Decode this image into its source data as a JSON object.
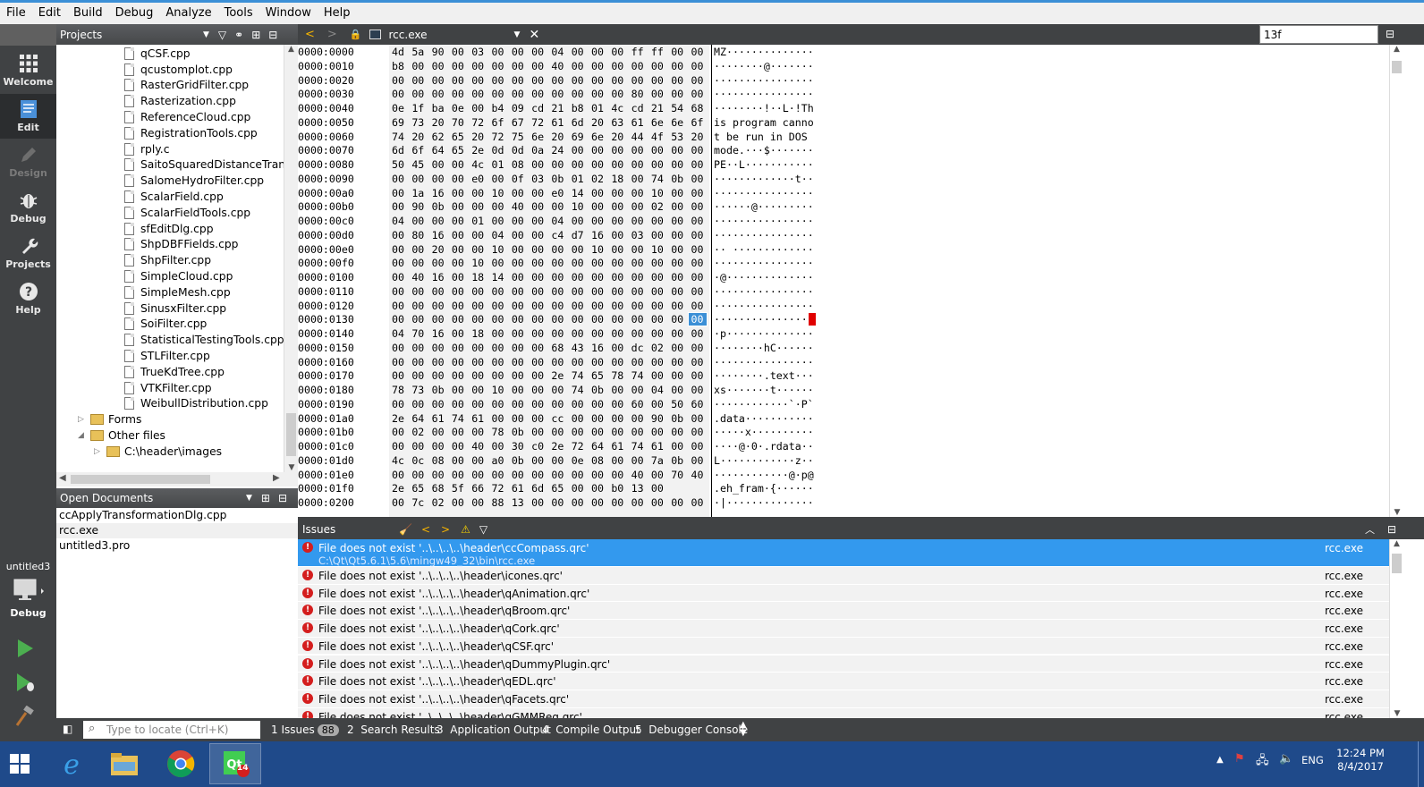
{
  "menu": [
    "File",
    "Edit",
    "Build",
    "Debug",
    "Analyze",
    "Tools",
    "Window",
    "Help"
  ],
  "modes": [
    {
      "label": "Welcome",
      "icon": "grid-icon",
      "state": "normal"
    },
    {
      "label": "Edit",
      "icon": "edit-icon",
      "state": "active"
    },
    {
      "label": "Design",
      "icon": "pencil-icon",
      "state": "disabled"
    },
    {
      "label": "Debug",
      "icon": "bug-icon",
      "state": "normal"
    },
    {
      "label": "Projects",
      "icon": "wrench-icon",
      "state": "normal"
    },
    {
      "label": "Help",
      "icon": "help-icon",
      "state": "normal"
    }
  ],
  "kit": {
    "project": "untitled3",
    "config": "Debug"
  },
  "projects_pane": {
    "title": "Projects",
    "files": [
      "qCSF.cpp",
      "qcustomplot.cpp",
      "RasterGridFilter.cpp",
      "Rasterization.cpp",
      "ReferenceCloud.cpp",
      "RegistrationTools.cpp",
      "rply.c",
      "SaitoSquaredDistanceTransform.cpp",
      "SalomeHydroFilter.cpp",
      "ScalarField.cpp",
      "ScalarFieldTools.cpp",
      "sfEditDlg.cpp",
      "ShpDBFFields.cpp",
      "ShpFilter.cpp",
      "SimpleCloud.cpp",
      "SimpleMesh.cpp",
      "SinusxFilter.cpp",
      "SoiFilter.cpp",
      "StatisticalTestingTools.cpp",
      "STLFilter.cpp",
      "TrueKdTree.cpp",
      "VTKFilter.cpp",
      "WeibullDistribution.cpp"
    ],
    "folders": [
      "Forms",
      "Other files",
      "C:\\header\\images"
    ]
  },
  "open_documents": {
    "title": "Open Documents",
    "items": [
      "ccApplyTransformationDlg.cpp",
      "rcc.exe",
      "untitled3.pro"
    ],
    "selected": 1
  },
  "editor": {
    "tab": "rcc.exe",
    "find_value": "13f"
  },
  "hex": {
    "rows": [
      {
        "addr": "0000:0000",
        "bytes": "4d 5a 90 00 03 00 00 00 04 00 00 00 ff ff 00 00",
        "ascii": "MZ··············"
      },
      {
        "addr": "0000:0010",
        "bytes": "b8 00 00 00 00 00 00 00 40 00 00 00 00 00 00 00",
        "ascii": "········@·······"
      },
      {
        "addr": "0000:0020",
        "bytes": "00 00 00 00 00 00 00 00 00 00 00 00 00 00 00 00",
        "ascii": "················"
      },
      {
        "addr": "0000:0030",
        "bytes": "00 00 00 00 00 00 00 00 00 00 00 00 80 00 00 00",
        "ascii": "················"
      },
      {
        "addr": "0000:0040",
        "bytes": "0e 1f ba 0e 00 b4 09 cd 21 b8 01 4c cd 21 54 68",
        "ascii": "········!··L·!Th"
      },
      {
        "addr": "0000:0050",
        "bytes": "69 73 20 70 72 6f 67 72 61 6d 20 63 61 6e 6e 6f",
        "ascii": "is program canno"
      },
      {
        "addr": "0000:0060",
        "bytes": "74 20 62 65 20 72 75 6e 20 69 6e 20 44 4f 53 20",
        "ascii": "t be run in DOS "
      },
      {
        "addr": "0000:0070",
        "bytes": "6d 6f 64 65 2e 0d 0d 0a 24 00 00 00 00 00 00 00",
        "ascii": "mode.···$·······"
      },
      {
        "addr": "0000:0080",
        "bytes": "50 45 00 00 4c 01 08 00 00 00 00 00 00 00 00 00",
        "ascii": "PE··L···········"
      },
      {
        "addr": "0000:0090",
        "bytes": "00 00 00 00 e0 00 0f 03 0b 01 02 18 00 74 0b 00",
        "ascii": "·············t··"
      },
      {
        "addr": "0000:00a0",
        "bytes": "00 1a 16 00 00 10 00 00 e0 14 00 00 00 10 00 00",
        "ascii": "················"
      },
      {
        "addr": "0000:00b0",
        "bytes": "00 90 0b 00 00 00 40 00 00 10 00 00 00 02 00 00",
        "ascii": "······@·········"
      },
      {
        "addr": "0000:00c0",
        "bytes": "04 00 00 00 01 00 00 00 04 00 00 00 00 00 00 00",
        "ascii": "················"
      },
      {
        "addr": "0000:00d0",
        "bytes": "00 80 16 00 00 04 00 00 c4 d7 16 00 03 00 00 00",
        "ascii": "················"
      },
      {
        "addr": "0000:00e0",
        "bytes": "00 00 20 00 00 10 00 00 00 00 10 00 00 10 00 00",
        "ascii": "·· ·············"
      },
      {
        "addr": "0000:00f0",
        "bytes": "00 00 00 00 10 00 00 00 00 00 00 00 00 00 00 00",
        "ascii": "················"
      },
      {
        "addr": "0000:0100",
        "bytes": "00 40 16 00 18 14 00 00 00 00 00 00 00 00 00 00",
        "ascii": "·@··············"
      },
      {
        "addr": "0000:0110",
        "bytes": "00 00 00 00 00 00 00 00 00 00 00 00 00 00 00 00",
        "ascii": "················"
      },
      {
        "addr": "0000:0120",
        "bytes": "00 00 00 00 00 00 00 00 00 00 00 00 00 00 00 00",
        "ascii": "················"
      },
      {
        "addr": "0000:0130",
        "bytes": "00 00 00 00 00 00 00 00 00 00 00 00 00 00 00 00",
        "ascii": "················"
      },
      {
        "addr": "0000:0140",
        "bytes": "04 70 16 00 18 00 00 00 00 00 00 00 00 00 00 00",
        "ascii": "·p··············"
      },
      {
        "addr": "0000:0150",
        "bytes": "00 00 00 00 00 00 00 00 68 43 16 00 dc 02 00 00",
        "ascii": "········hC······"
      },
      {
        "addr": "0000:0160",
        "bytes": "00 00 00 00 00 00 00 00 00 00 00 00 00 00 00 00",
        "ascii": "················"
      },
      {
        "addr": "0000:0170",
        "bytes": "00 00 00 00 00 00 00 00 2e 74 65 78 74 00 00 00",
        "ascii": "········.text···"
      },
      {
        "addr": "0000:0180",
        "bytes": "78 73 0b 00 00 10 00 00 00 74 0b 00 00 04 00 00",
        "ascii": "xs·······t······"
      },
      {
        "addr": "0000:0190",
        "bytes": "00 00 00 00 00 00 00 00 00 00 00 00 60 00 50 60",
        "ascii": "············`·P`"
      },
      {
        "addr": "0000:01a0",
        "bytes": "2e 64 61 74 61 00 00 00 cc 00 00 00 00 90 0b 00",
        "ascii": ".data···········"
      },
      {
        "addr": "0000:01b0",
        "bytes": "00 02 00 00 00 78 0b 00 00 00 00 00 00 00 00 00",
        "ascii": "·····x··········"
      },
      {
        "addr": "0000:01c0",
        "bytes": "00 00 00 00 40 00 30 c0 2e 72 64 61 74 61 00 00",
        "ascii": "····@·0·.rdata··"
      },
      {
        "addr": "0000:01d0",
        "bytes": "4c 0c 08 00 00 a0 0b 00 00 0e 08 00 00 7a 0b 00",
        "ascii": "L············z··"
      },
      {
        "addr": "0000:01e0",
        "bytes": "00 00 00 00 00 00 00 00 00 00 00 00 40 00 70 40",
        "ascii": "············@·p@"
      },
      {
        "addr": "0000:01f0",
        "bytes": "2e 65 68 5f 66 72 61 6d 65 00 00 b0 13 00",
        "ascii": ".eh_fram·{······"
      },
      {
        "addr": "0000:0200",
        "bytes": "00 7c 02 00 00 88 13 00 00 00 00 00 00 00 00 00",
        "ascii": "·|··············"
      }
    ],
    "cursor": {
      "row": 19,
      "col": 15
    }
  },
  "issues": {
    "title": "Issues",
    "items": [
      {
        "text": "File does not exist '..\\..\\..\\..\\header\\ccCompass.qrc'",
        "sub": "C:\\Qt\\Qt5.6.1\\5.6\\mingw49_32\\bin\\rcc.exe",
        "file": "rcc.exe"
      },
      {
        "text": "File does not exist '..\\..\\..\\..\\header\\icones.qrc'",
        "file": "rcc.exe"
      },
      {
        "text": "File does not exist '..\\..\\..\\..\\header\\qAnimation.qrc'",
        "file": "rcc.exe"
      },
      {
        "text": "File does not exist '..\\..\\..\\..\\header\\qBroom.qrc'",
        "file": "rcc.exe"
      },
      {
        "text": "File does not exist '..\\..\\..\\..\\header\\qCork.qrc'",
        "file": "rcc.exe"
      },
      {
        "text": "File does not exist '..\\..\\..\\..\\header\\qCSF.qrc'",
        "file": "rcc.exe"
      },
      {
        "text": "File does not exist '..\\..\\..\\..\\header\\qDummyPlugin.qrc'",
        "file": "rcc.exe"
      },
      {
        "text": "File does not exist '..\\..\\..\\..\\header\\qEDL.qrc'",
        "file": "rcc.exe"
      },
      {
        "text": "File does not exist '..\\..\\..\\..\\header\\qFacets.qrc'",
        "file": "rcc.exe"
      },
      {
        "text": "File does not exist '..\\..\\..\\..\\header\\qGMMReg.qrc'",
        "file": "rcc.exe"
      }
    ]
  },
  "bottom": {
    "locator_placeholder": "Type to locate (Ctrl+K)",
    "tabs": [
      {
        "num": "1",
        "label": "Issues",
        "badge": "88"
      },
      {
        "num": "2",
        "label": "Search Results"
      },
      {
        "num": "3",
        "label": "Application Output"
      },
      {
        "num": "4",
        "label": "Compile Output"
      },
      {
        "num": "5",
        "label": "Debugger Console"
      }
    ]
  },
  "taskbar": {
    "lang": "ENG",
    "time": "12:24 PM",
    "date": "8/4/2017",
    "qt_badge": "14"
  }
}
